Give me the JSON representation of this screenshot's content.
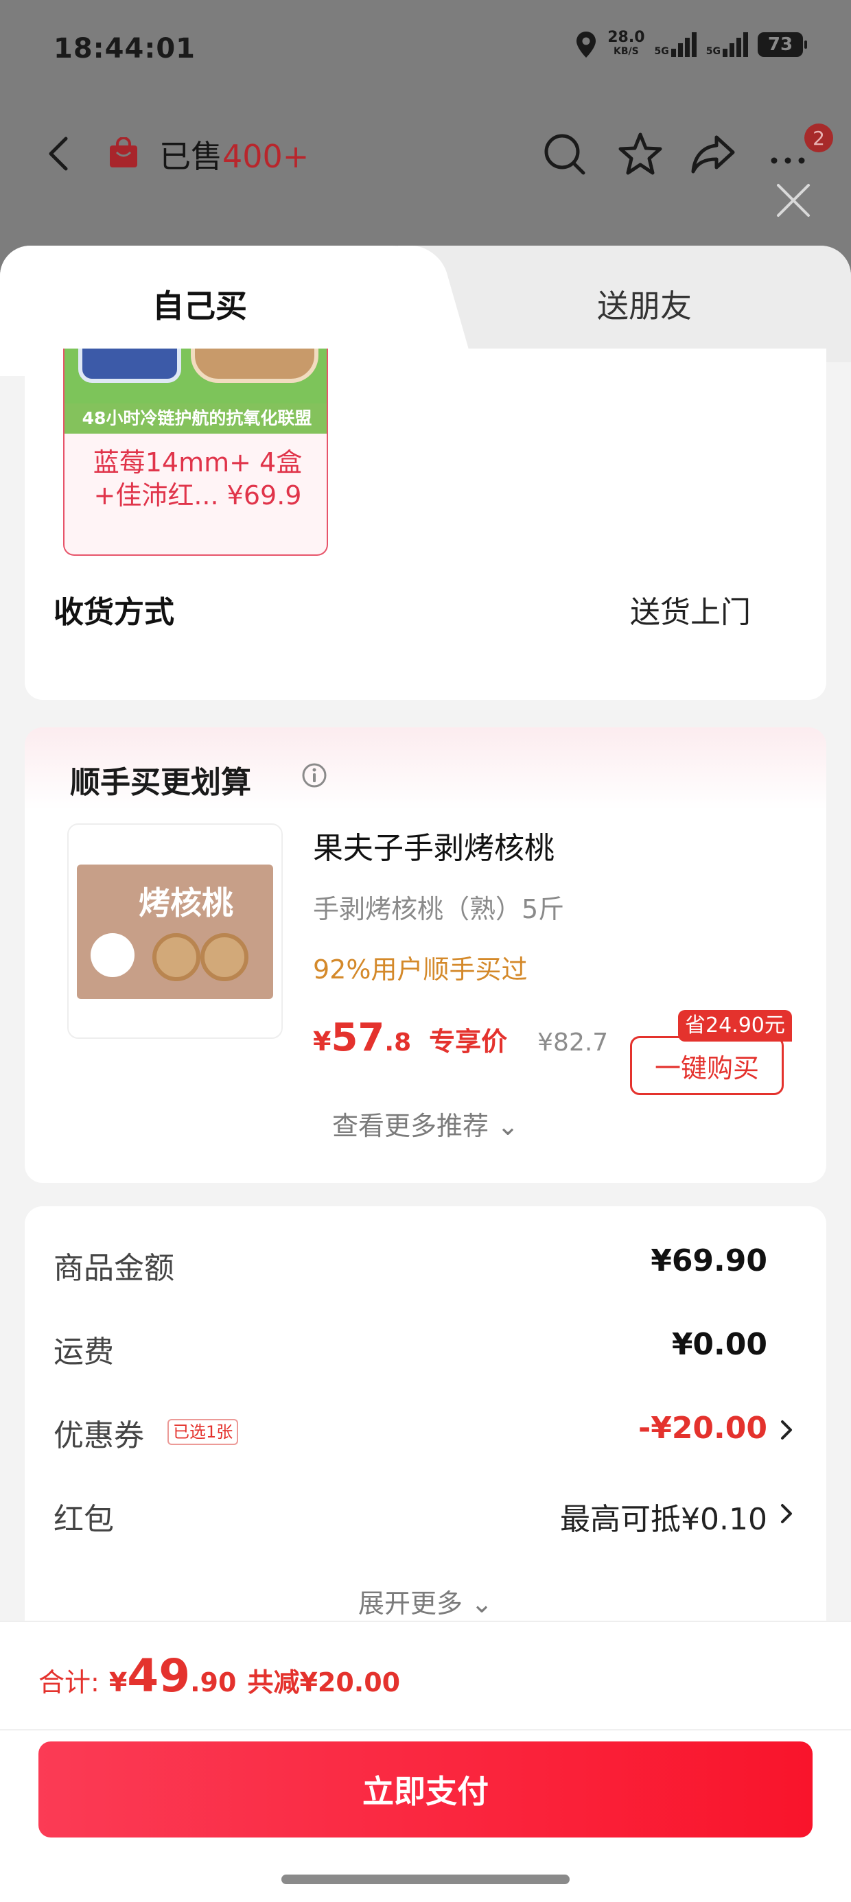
{
  "status_bar": {
    "time": "18:44:01",
    "net_speed": "28.0",
    "net_unit": "KB/S",
    "sig1": "5G",
    "sig2": "5G",
    "battery": "73"
  },
  "nav": {
    "sold_prefix": "已售",
    "sold_count": "400+",
    "badge_count": "2"
  },
  "tabs": {
    "self": "自己买",
    "friend": "送朋友"
  },
  "bundle": {
    "strip": "48小时冷链护航的抗氧化联盟",
    "title": "蓝莓14mm+ 4盒 +佳沛红... ¥69.9"
  },
  "shipping": {
    "label": "收货方式",
    "value": "送货上门"
  },
  "recommend": {
    "title": "顺手买更划算",
    "product": {
      "image_brand": "烤核桃",
      "name": "果夫子手剥烤核桃",
      "spec": "手剥烤核桃（熟）5斤",
      "bought": "92%用户顺手买过",
      "price_currency": "¥",
      "price_int": "57",
      "price_dec": ".8",
      "price_tag": "专享价",
      "old_price": "¥82.7",
      "save_badge": "省24.90元",
      "buy_label": "一键购买"
    },
    "more": "查看更多推荐 ⌄"
  },
  "summary": {
    "rows": [
      {
        "label": "商品金额",
        "value": "¥69.90"
      },
      {
        "label": "运费",
        "value": "¥0.00"
      },
      {
        "label": "优惠券",
        "tag": "已选1张",
        "value": "-¥20.00"
      },
      {
        "label": "红包",
        "value": "最高可抵¥0.10"
      }
    ],
    "expand": "展开更多 ⌄"
  },
  "footer": {
    "total_label": "合计:",
    "total_currency": "¥",
    "total_int": "49",
    "total_dec": ".90",
    "discount": "共减¥20.00",
    "pay_label": "立即支付"
  },
  "colors": {
    "accent": "#e4322d",
    "pay_gradient_start": "#fb3b55",
    "pay_gradient_end": "#f9142b",
    "bought_text": "#d4892a"
  }
}
